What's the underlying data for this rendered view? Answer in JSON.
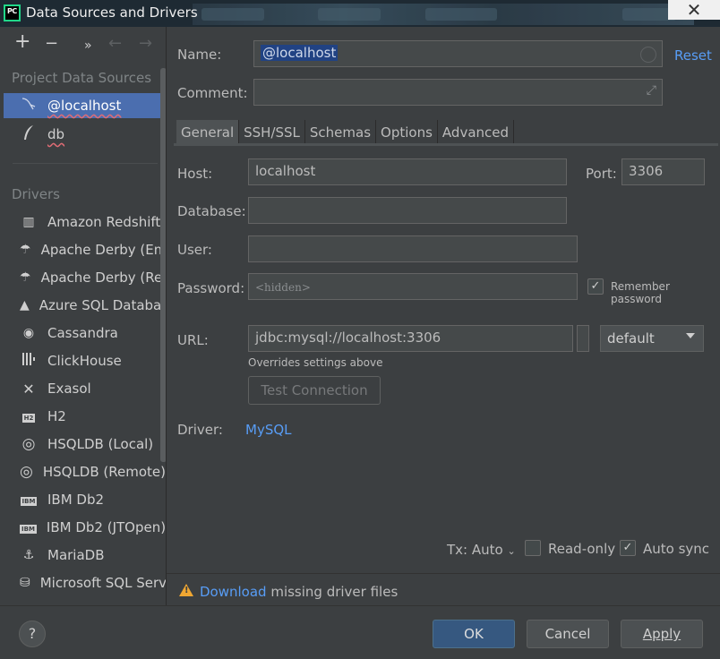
{
  "window": {
    "title": "Data Sources and Drivers",
    "close_glyph": "✕",
    "app_icon_text": "PC"
  },
  "toolbar": {
    "add": "+",
    "remove": "−",
    "more": "»",
    "back": "←",
    "forward": "→"
  },
  "sidebar": {
    "project_title": "Project Data Sources",
    "project_items": [
      {
        "label": "@localhost",
        "icon": "mysql-dolphin-icon"
      },
      {
        "label": "db",
        "icon": "sqlite-feather-icon"
      }
    ],
    "drivers_title": "Drivers",
    "drivers": [
      {
        "label": "Amazon Redshift",
        "icon": "redshift-icon",
        "glyph": "▥"
      },
      {
        "label": "Apache Derby (Emb",
        "icon": "derby-hat-icon",
        "glyph": "☂"
      },
      {
        "label": "Apache Derby (Ren",
        "icon": "derby-hat-icon",
        "glyph": "☂"
      },
      {
        "label": "Azure SQL Databas",
        "icon": "azure-icon",
        "glyph": "▲"
      },
      {
        "label": "Cassandra",
        "icon": "cassandra-eye-icon",
        "glyph": "◉"
      },
      {
        "label": "ClickHouse",
        "icon": "clickhouse-bars-icon",
        "glyph": "▮"
      },
      {
        "label": "Exasol",
        "icon": "exasol-x-icon",
        "glyph": "✕"
      },
      {
        "label": "H2",
        "icon": "h2-icon",
        "glyph": "H2"
      },
      {
        "label": "HSQLDB (Local)",
        "icon": "hsqldb-icon",
        "glyph": "◎"
      },
      {
        "label": "HSQLDB (Remote)",
        "icon": "hsqldb-icon",
        "glyph": "◎"
      },
      {
        "label": "IBM Db2",
        "icon": "ibm-db2-icon",
        "glyph": "IBM"
      },
      {
        "label": "IBM Db2 (JTOpen)",
        "icon": "ibm-db2-icon",
        "glyph": "IBM"
      },
      {
        "label": "MariaDB",
        "icon": "mariadb-seal-icon",
        "glyph": "⚓"
      },
      {
        "label": "Microsoft SQL Serv",
        "icon": "mssql-icon",
        "glyph": "⛁"
      }
    ]
  },
  "form": {
    "name_label": "Name:",
    "name_value": "@localhost",
    "reset_label": "Reset",
    "comment_label": "Comment:",
    "comment_value": "",
    "tabs": [
      "General",
      "SSH/SSL",
      "Schemas",
      "Options",
      "Advanced"
    ],
    "host_label": "Host:",
    "host_value": "localhost",
    "port_label": "Port:",
    "port_value": "3306",
    "database_label": "Database:",
    "database_value": "",
    "user_label": "User:",
    "user_value": "",
    "password_label": "Password:",
    "password_placeholder": "<hidden>",
    "remember_password_label": "Remember password",
    "remember_password_checked": true,
    "url_label": "URL:",
    "url_value": "jdbc:mysql://localhost:3306",
    "url_mode": "default",
    "url_hint": "Overrides settings above",
    "test_connection_label": "Test Connection",
    "driver_label": "Driver:",
    "driver_value": "MySQL",
    "tx_label": "Tx: Auto",
    "read_only_label": "Read-only",
    "read_only_checked": false,
    "auto_sync_label": "Auto sync",
    "auto_sync_checked": true
  },
  "warning": {
    "link": "Download",
    "text": " missing driver files"
  },
  "buttons": {
    "help": "?",
    "ok": "OK",
    "cancel": "Cancel",
    "apply": "Apply"
  },
  "colors": {
    "accent": "#4b6eaf",
    "link": "#589df6",
    "warning": "#f0a732",
    "background": "#3c3f41"
  }
}
